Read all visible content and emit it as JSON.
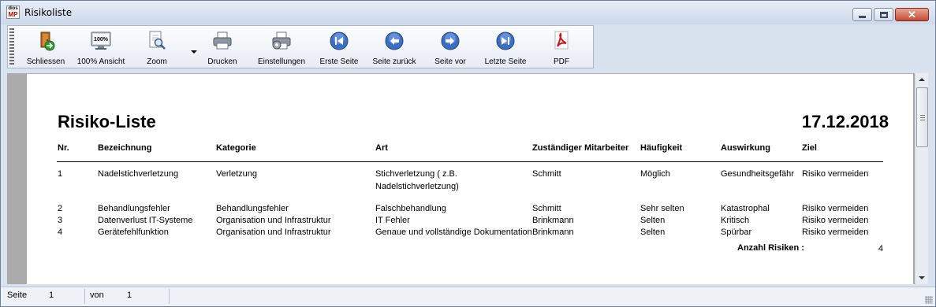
{
  "window": {
    "title": "Risikoliste",
    "icon_top": "dios",
    "icon_bottom": "MP"
  },
  "toolbar": {
    "close_label": "Schliessen",
    "zoom100_label": "100% Ansicht",
    "zoom100_icon_text": "100%",
    "zoom_label": "Zoom",
    "print_label": "Drucken",
    "settings_label": "Einstellungen",
    "first_label": "Erste Seite",
    "prev_label": "Seite zurück",
    "next_label": "Seite vor",
    "last_label": "Letzte Seite",
    "pdf_label": "PDF"
  },
  "report": {
    "title": "Risiko-Liste",
    "date": "17.12.2018",
    "headers": {
      "nr": "Nr.",
      "bezeichnung": "Bezeichnung",
      "kategorie": "Kategorie",
      "art": "Art",
      "mitarbeiter": "Zuständiger Mitarbeiter",
      "haeufigkeit": "Häufigkeit",
      "auswirkung": "Auswirkung",
      "ziel": "Ziel"
    },
    "rows": [
      {
        "nr": "1",
        "bezeichnung": "Nadelstichverletzung",
        "kategorie": "Verletzung",
        "art_line1": "Stichverletzung ( z.B.",
        "art_line2": "Nadelstichverletzung)",
        "mitarbeiter": "Schmitt",
        "haeufigkeit": "Möglich",
        "auswirkung": "Gesundheitsgefähr",
        "ziel": "Risiko vermeiden"
      },
      {
        "nr": "2",
        "bezeichnung": "Behandlungsfehler",
        "kategorie": "Behandlungsfehler",
        "art_line1": "Falschbehandlung",
        "art_line2": "",
        "mitarbeiter": "Schmitt",
        "haeufigkeit": "Sehr selten",
        "auswirkung": "Katastrophal",
        "ziel": "Risiko vermeiden"
      },
      {
        "nr": "3",
        "bezeichnung": "Datenverlust IT-Systeme",
        "kategorie": "Organisation und Infrastruktur",
        "art_line1": "IT Fehler",
        "art_line2": "",
        "mitarbeiter": "Brinkmann",
        "haeufigkeit": "Selten",
        "auswirkung": "Kritisch",
        "ziel": "Risiko vermeiden"
      },
      {
        "nr": "4",
        "bezeichnung": "Gerätefehlfunktion",
        "kategorie": "Organisation und Infrastruktur",
        "art_line1": "Genaue und vollständige Dokumentation",
        "art_line2": "",
        "mitarbeiter": "Brinkmann",
        "haeufigkeit": "Selten",
        "auswirkung": "Spürbar",
        "ziel": "Risiko vermeiden"
      }
    ],
    "count_label": "Anzahl Risiken :",
    "count_value": "4"
  },
  "statusbar": {
    "page_label": "Seite",
    "page_value": "1",
    "of_label": "von",
    "of_value": "1"
  },
  "colors": {
    "pdf_red": "#d0141e",
    "nav_blue": "#3b6fc4",
    "green_arrow": "#2f9a2f"
  },
  "icons": {
    "close": "door-exit-icon",
    "zoom100": "monitor-100-icon",
    "zoom": "magnifier-page-icon",
    "print": "printer-icon",
    "settings": "printer-settings-icon",
    "first": "first-page-icon",
    "prev": "previous-page-icon",
    "next": "next-page-icon",
    "last": "last-page-icon",
    "pdf": "pdf-icon"
  }
}
